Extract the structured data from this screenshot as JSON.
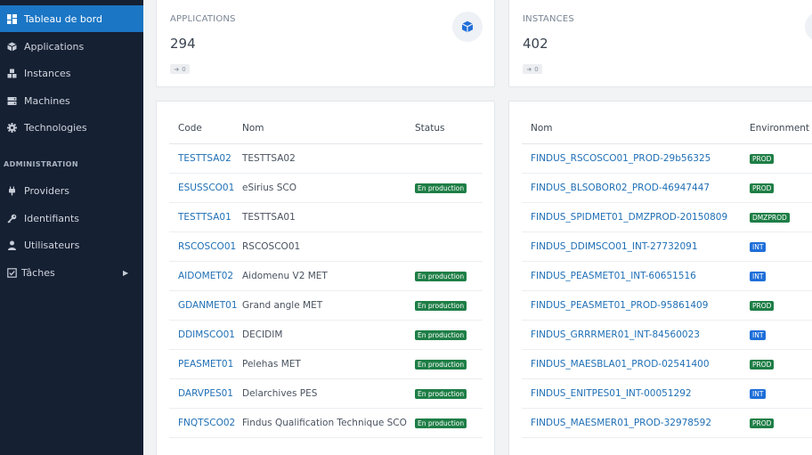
{
  "sidebar": {
    "items": [
      {
        "label": "Tableau de bord",
        "icon": "dashboard-icon"
      },
      {
        "label": "Applications",
        "icon": "cube-icon"
      },
      {
        "label": "Instances",
        "icon": "cubes-icon"
      },
      {
        "label": "Machines",
        "icon": "server-icon"
      },
      {
        "label": "Technologies",
        "icon": "gear-icon"
      }
    ],
    "section_title": "ADMINISTRATION",
    "admin_items": [
      {
        "label": "Providers",
        "icon": "plug-icon"
      },
      {
        "label": "Identifiants",
        "icon": "key-icon"
      },
      {
        "label": "Utilisateurs",
        "icon": "user-icon"
      },
      {
        "label": "Tâches",
        "icon": "tasks-icon"
      }
    ]
  },
  "stats": {
    "applications": {
      "title": "APPLICATIONS",
      "value": "294",
      "chip": "0"
    },
    "instances": {
      "title": "INSTANCES",
      "value": "402",
      "chip": "0"
    }
  },
  "apps_table": {
    "headers": [
      "Code",
      "Nom",
      "Status"
    ],
    "rows": [
      {
        "code": "TESTTSA02",
        "nom": "TESTTSA02",
        "status": ""
      },
      {
        "code": "ESUSSCO01",
        "nom": "eSirius SCO",
        "status": "En production"
      },
      {
        "code": "TESTTSA01",
        "nom": "TESTTSA01",
        "status": ""
      },
      {
        "code": "RSCOSCO01",
        "nom": "RSCOSCO01",
        "status": ""
      },
      {
        "code": "AIDOMET02",
        "nom": "Aidomenu V2 MET",
        "status": "En production"
      },
      {
        "code": "GDANMET01",
        "nom": "Grand angle MET",
        "status": "En production"
      },
      {
        "code": "DDIMSCO01",
        "nom": "DECIDIM",
        "status": "En production"
      },
      {
        "code": "PEASMET01",
        "nom": "Pelehas MET",
        "status": "En production"
      },
      {
        "code": "DARVPES01",
        "nom": "Delarchives PES",
        "status": "En production"
      },
      {
        "code": "FNQTSCO02",
        "nom": "Findus Qualification Technique SCO",
        "status": "En production"
      }
    ]
  },
  "instances_table": {
    "headers": [
      "Nom",
      "Environment"
    ],
    "rows": [
      {
        "nom": "FINDUS_RSCOSCO01_PROD-29b56325",
        "env": "PROD"
      },
      {
        "nom": "FINDUS_BLSOBOR02_PROD-46947447",
        "env": "PROD"
      },
      {
        "nom": "FINDUS_SPIDMET01_DMZPROD-20150809",
        "env": "DMZPROD"
      },
      {
        "nom": "FINDUS_DDIMSCO01_INT-27732091",
        "env": "INT"
      },
      {
        "nom": "FINDUS_PEASMET01_INT-60651516",
        "env": "INT"
      },
      {
        "nom": "FINDUS_PEASMET01_PROD-95861409",
        "env": "PROD"
      },
      {
        "nom": "FINDUS_GRRRMER01_INT-84560023",
        "env": "INT"
      },
      {
        "nom": "FINDUS_MAESBLA01_PROD-02541400",
        "env": "PROD"
      },
      {
        "nom": "FINDUS_ENITPES01_INT-00051292",
        "env": "INT"
      },
      {
        "nom": "FINDUS_MAESMER01_PROD-32978592",
        "env": "PROD"
      }
    ]
  },
  "colors": {
    "sidebar_bg": "#152033",
    "active": "#1b76c5",
    "link": "#1f6fb5",
    "prod_badge": "#1e7e46",
    "int_badge": "#1e6fd9"
  }
}
